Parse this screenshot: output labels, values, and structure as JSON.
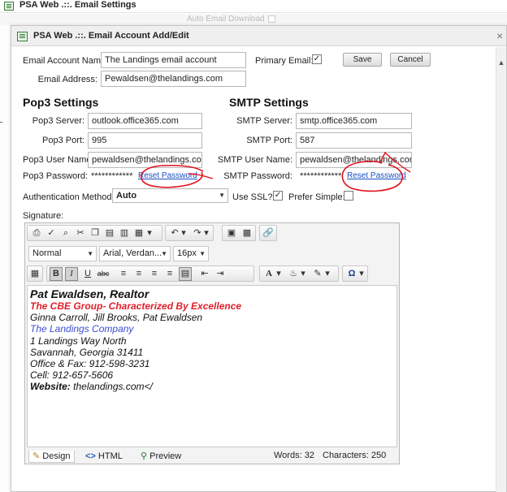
{
  "bg_window": {
    "title": "PSA Web .::. Email Settings",
    "hidden_label": "Auto Email Download"
  },
  "dialog": {
    "title": "PSA Web .::. Email Account Add/Edit",
    "close_glyph": "×"
  },
  "account": {
    "name_label": "Email Account Name:",
    "name_value": "The Landings email account",
    "address_label": "Email Address:",
    "address_value": "Pewaldsen@thelandings.com",
    "primary_label": "Primary Email:",
    "primary_checked_glyph": "✓",
    "save_label": "Save",
    "cancel_label": "Cancel"
  },
  "pop3": {
    "heading": "Pop3 Settings",
    "server_label": "Pop3 Server:",
    "server_value": "outlook.office365.com",
    "port_label": "Pop3 Port:",
    "port_value": "995",
    "user_label": "Pop3 User Name:",
    "user_value": "pewaldsen@thelandings.com",
    "password_label": "Pop3 Password:",
    "password_mask": "************",
    "reset_label": "Reset Password"
  },
  "smtp": {
    "heading": "SMTP Settings",
    "server_label": "SMTP Server:",
    "server_value": "smtp.office365.com",
    "port_label": "SMTP Port:",
    "port_value": "587",
    "user_label": "SMTP User Name:",
    "user_value": "pewaldsen@thelandings.com",
    "password_label": "SMTP Password:",
    "password_mask": "************",
    "reset_label": "Reset Password"
  },
  "auth": {
    "label": "Authentication Method:",
    "value": "Auto",
    "ssl_label": "Use SSL?:",
    "ssl_checked_glyph": "✓",
    "prefer_simple_label": "Prefer Simple:"
  },
  "signature": {
    "label": "Signature:",
    "toolbar": {
      "format_value": "Normal",
      "font_value": "Arial, Verdan...",
      "size_value": "16px",
      "bold": "B",
      "italic": "I",
      "underline": "U",
      "strike": "abc",
      "font_color_glyph": "A",
      "special_char_glyph": "Ω"
    },
    "lines": {
      "name": "Pat Ewaldsen, Realtor",
      "group": "The CBE Group- Characterized By Excellence",
      "team": "Ginna Carroll, Jill Brooks, Pat Ewaldsen",
      "company": "The Landings Company",
      "street": "1 Landings Way North",
      "city": "Savannah, Georgia 31411",
      "office": "Office & Fax:  912-598-3231",
      "cell": "Cell:  912-657-5606",
      "website_label": "Website:",
      "website_value": " thelandings.com</"
    },
    "footer": {
      "design_tab": "Design",
      "html_tab": "HTML",
      "preview_tab": "Preview",
      "words": "Words: 32",
      "characters": "Characters: 250"
    }
  },
  "colors": {
    "link": "#1a4fc4",
    "signature_red": "#e0202a",
    "signature_blue": "#3a4fd0",
    "annotation_red": "#e0101a"
  }
}
